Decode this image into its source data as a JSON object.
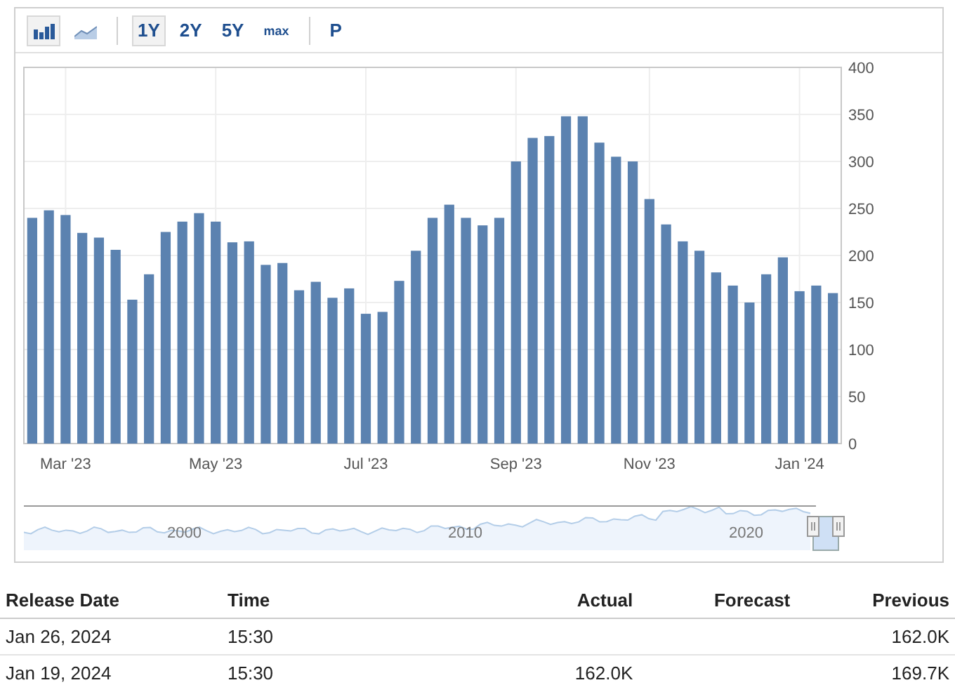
{
  "toolbar": {
    "chart_types": [
      {
        "kind": "bar",
        "selected": true
      },
      {
        "kind": "area",
        "selected": false
      }
    ],
    "ranges": [
      {
        "label": "1Y",
        "selected": true
      },
      {
        "label": "2Y",
        "selected": false
      },
      {
        "label": "5Y",
        "selected": false
      },
      {
        "label": "max",
        "selected": false,
        "kind": "small"
      }
    ],
    "preliminary": {
      "label": "P",
      "selected": false
    }
  },
  "chart": {
    "chart_data": {
      "type": "bar",
      "categories": [
        null,
        null,
        "Mar '23",
        null,
        null,
        null,
        null,
        null,
        null,
        null,
        null,
        "May '23",
        null,
        null,
        null,
        null,
        null,
        null,
        null,
        null,
        "Jul '23",
        null,
        null,
        null,
        null,
        null,
        null,
        null,
        null,
        "Sep '23",
        null,
        null,
        null,
        null,
        null,
        null,
        null,
        "Nov '23",
        null,
        null,
        null,
        null,
        null,
        null,
        null,
        null,
        "Jan '24",
        null,
        null
      ],
      "series": [
        {
          "color": "#5b82b0",
          "values": [
            240,
            248,
            243,
            224,
            219,
            206,
            153,
            180,
            225,
            236,
            245,
            236,
            214,
            215,
            190,
            192,
            163,
            172,
            155,
            165,
            138,
            140,
            173,
            205,
            240,
            254,
            240,
            232,
            240,
            300,
            325,
            327,
            348,
            348,
            320,
            305,
            300,
            260,
            233,
            215,
            205,
            182,
            168,
            150,
            180,
            198,
            162,
            168,
            160
          ]
        }
      ],
      "grid": true,
      "ylim": [
        0,
        400
      ],
      "yticks": [
        0,
        50,
        100,
        150,
        200,
        250,
        300,
        350,
        400
      ]
    }
  },
  "navigator": {
    "labels": [
      "2000",
      "2010",
      "2020"
    ]
  },
  "table": {
    "columns": [
      "Release Date",
      "Time",
      "Actual",
      "Forecast",
      "Previous"
    ],
    "rows": [
      {
        "release_date": "Jan 26, 2024",
        "time": "15:30",
        "previous": "162.0K"
      },
      {
        "release_date": "Jan 19, 2024",
        "time": "15:30",
        "actual": "162.0K",
        "previous": "169.7K"
      }
    ]
  }
}
